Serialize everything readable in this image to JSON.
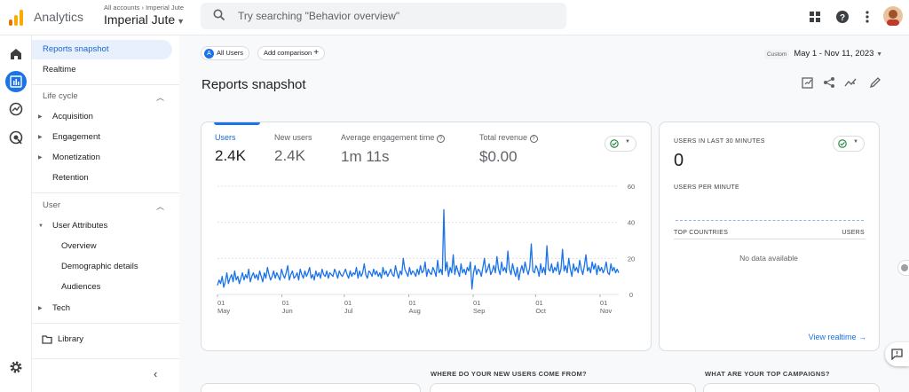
{
  "header": {
    "app_name": "Analytics",
    "breadcrumb": "All accounts › Imperial Jute",
    "property_name": "Imperial Jute",
    "search_placeholder": "Try searching \"Behavior overview\""
  },
  "nav": {
    "items": [
      {
        "label": "Reports snapshot",
        "active": true
      },
      {
        "label": "Realtime"
      }
    ],
    "lifecycle": {
      "heading": "Life cycle",
      "items": [
        "Acquisition",
        "Engagement",
        "Monetization",
        "Retention"
      ]
    },
    "user": {
      "heading": "User",
      "attributes_label": "User Attributes",
      "sub_items": [
        "Overview",
        "Demographic details",
        "Audiences"
      ],
      "tech_label": "Tech"
    },
    "library_label": "Library"
  },
  "toolbar": {
    "segment_badge": "A",
    "segment_label": "All Users",
    "add_comparison": "Add comparison",
    "date_custom": "Custom",
    "date_range": "May 1 - Nov 11, 2023"
  },
  "page_title": "Reports snapshot",
  "metrics": [
    {
      "label": "Users",
      "value": "2.4K"
    },
    {
      "label": "New users",
      "value": "2.4K"
    },
    {
      "label": "Average engagement time",
      "value": "1m 11s"
    },
    {
      "label": "Total revenue",
      "value": "$0.00"
    }
  ],
  "realtime": {
    "title": "USERS IN LAST 30 MINUTES",
    "value": "0",
    "per_minute": "USERS PER MINUTE",
    "top_countries": "TOP COUNTRIES",
    "users_col": "USERS",
    "no_data": "No data available",
    "link": "View realtime"
  },
  "sections": {
    "new_users": "WHERE DO YOUR NEW USERS COME FROM?",
    "campaigns": "WHAT ARE YOUR TOP CAMPAIGNS?"
  },
  "colors": {
    "accent": "#1a73e8",
    "active_nav_bg": "#e8f0fe",
    "success": "#188038"
  },
  "chart_data": {
    "type": "line",
    "x_tick_labels": [
      {
        "day": "01",
        "month": "May"
      },
      {
        "day": "01",
        "month": "Jun"
      },
      {
        "day": "01",
        "month": "Jul"
      },
      {
        "day": "01",
        "month": "Aug"
      },
      {
        "day": "01",
        "month": "Sep"
      },
      {
        "day": "01",
        "month": "Oct"
      },
      {
        "day": "01",
        "month": "Nov"
      }
    ],
    "y_ticks": [
      0,
      20,
      40,
      60
    ],
    "ylim": [
      0,
      60
    ],
    "series": [
      {
        "values": [
          5,
          8,
          6,
          10,
          4,
          7,
          12,
          6,
          9,
          11,
          7,
          13,
          8,
          10,
          6,
          9,
          12,
          8,
          11,
          9,
          14,
          7,
          10,
          12,
          9,
          11,
          8,
          13,
          10,
          7,
          12,
          9,
          15,
          11,
          8,
          10,
          13,
          9,
          12,
          10,
          8,
          14,
          11,
          9,
          12,
          16,
          8,
          11,
          13,
          9,
          10,
          12,
          8,
          14,
          11,
          9,
          13,
          10,
          12,
          15,
          9,
          11,
          8,
          13,
          10,
          12,
          9,
          14,
          11,
          10,
          13,
          9,
          12,
          11,
          10,
          14,
          12,
          9,
          13,
          11,
          10,
          12,
          14,
          11,
          9,
          13,
          10,
          12,
          11,
          15,
          9,
          13,
          10,
          12,
          17,
          11,
          9,
          13,
          12,
          10,
          14,
          11,
          13,
          10,
          12,
          9,
          15,
          11,
          13,
          10,
          12,
          14,
          11,
          10,
          16,
          12,
          9,
          13,
          11,
          20,
          14,
          12,
          10,
          15,
          11,
          13,
          12,
          10,
          14,
          11,
          16,
          12,
          13,
          18,
          10,
          14,
          12,
          11,
          15,
          13,
          10,
          19,
          12,
          14,
          11,
          47,
          13,
          18,
          10,
          15,
          12,
          22,
          11,
          16,
          13,
          10,
          17,
          12,
          14,
          11,
          15,
          13,
          18,
          3,
          12,
          16,
          11,
          14,
          13,
          10,
          15,
          20,
          12,
          14,
          17,
          11,
          13,
          16,
          12,
          21,
          14,
          11,
          18,
          13,
          15,
          12,
          24,
          14,
          11,
          17,
          13,
          10,
          15,
          8,
          13,
          16,
          12,
          18,
          14,
          11,
          15,
          28,
          13,
          12,
          16,
          14,
          10,
          17,
          12,
          15,
          11,
          27,
          14,
          13,
          17,
          12,
          15,
          13,
          18,
          11,
          14,
          25,
          13,
          16,
          12,
          20,
          14,
          10,
          17,
          13,
          15,
          12,
          19,
          14,
          11,
          16,
          22,
          13,
          15,
          12,
          18,
          14,
          17,
          11,
          16,
          13,
          15,
          12,
          14,
          18,
          12,
          11,
          17,
          13,
          15,
          12,
          14,
          12
        ]
      }
    ]
  }
}
